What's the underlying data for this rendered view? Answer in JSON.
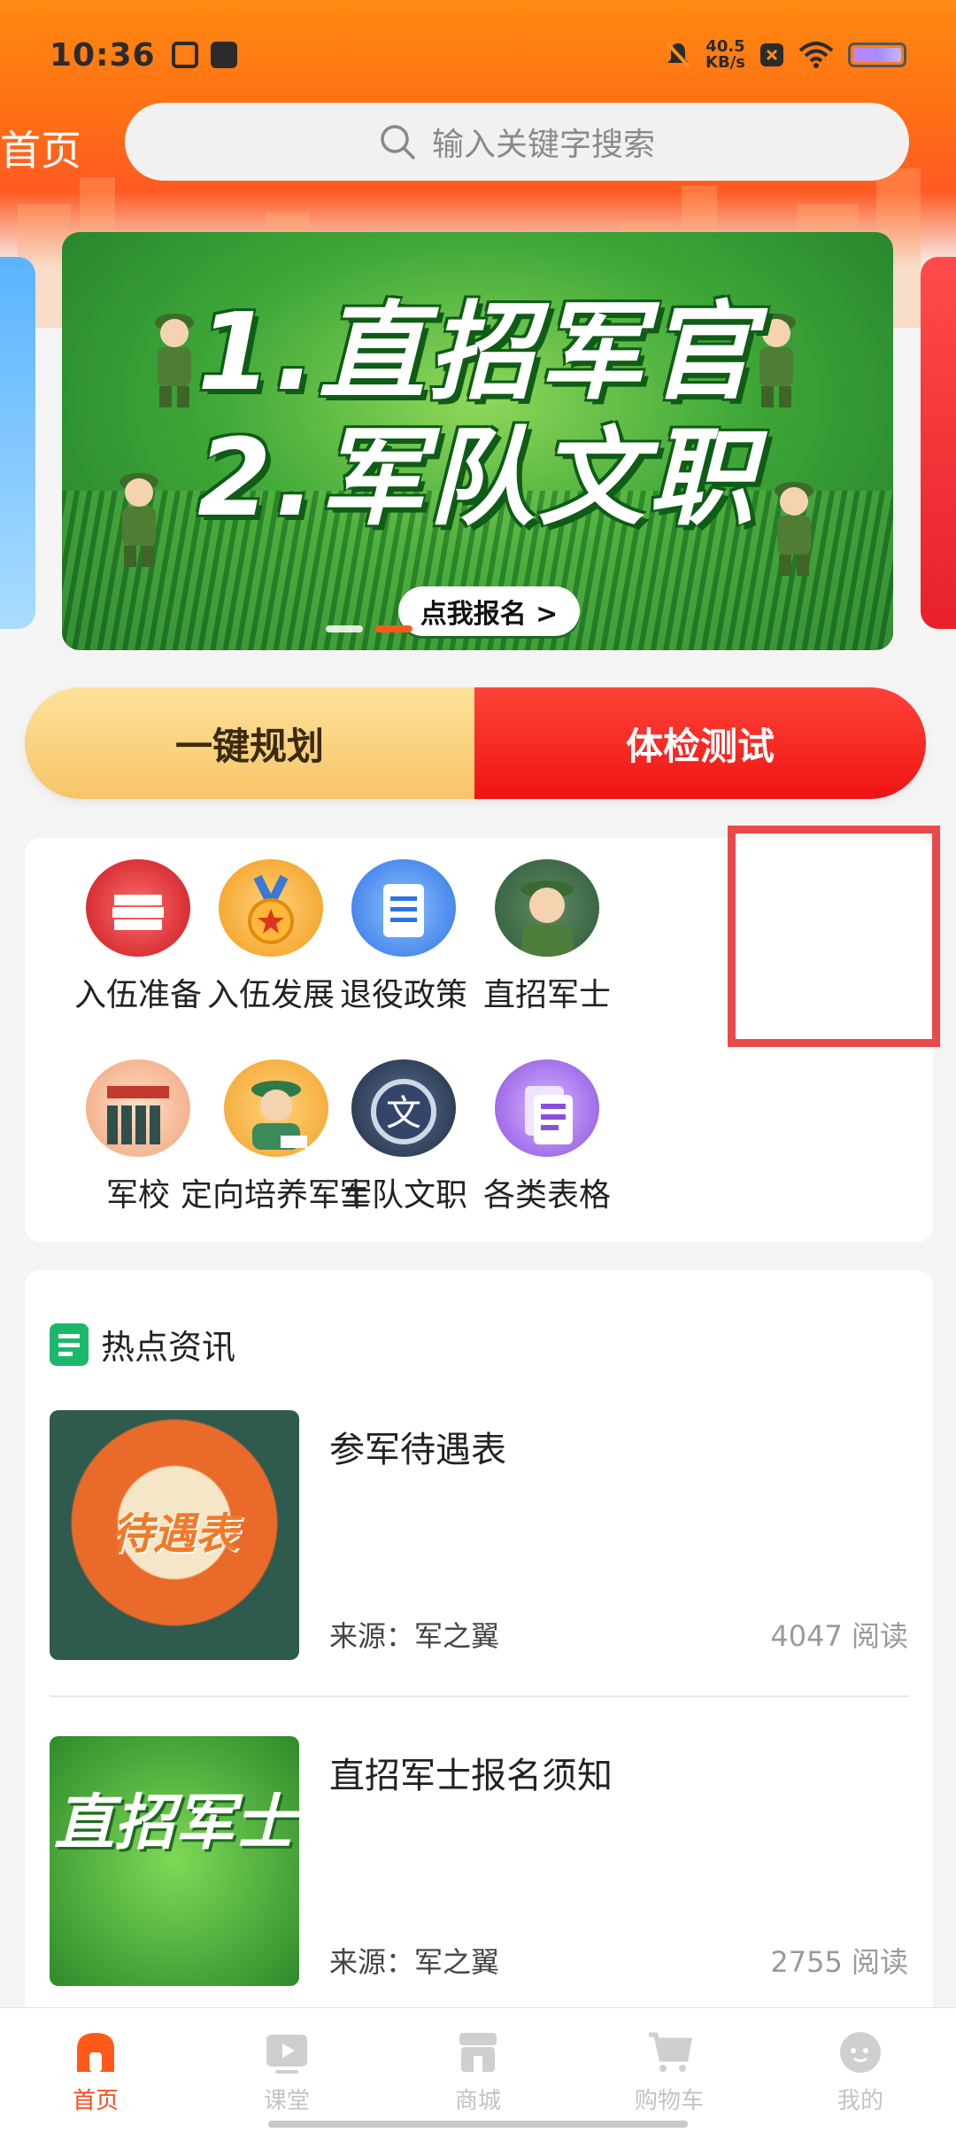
{
  "status_bar": {
    "time": "10:36",
    "speed_value": "40.5",
    "speed_unit": "KB/s",
    "icons": [
      "mute-icon",
      "close-box-icon",
      "wifi-icon",
      "battery-icon"
    ]
  },
  "header": {
    "title": "首页",
    "search_placeholder": "输入关键字搜索"
  },
  "banner": {
    "line1": "1.直招军官",
    "line2": "2.军队文职",
    "cta": "点我报名 >",
    "slide_count": 3,
    "active_slide": 2
  },
  "actions": {
    "left_label": "一键规划",
    "right_label": "体检测试"
  },
  "grid": {
    "items": [
      {
        "label": "入伍准备",
        "icon": "documents-icon"
      },
      {
        "label": "入伍发展",
        "icon": "medal-icon"
      },
      {
        "label": "退役政策",
        "icon": "document-icon"
      },
      {
        "label": "直招军士",
        "icon": "soldier-icon"
      },
      {
        "label": "军校",
        "icon": "parade-icon"
      },
      {
        "label": "定向培养军士",
        "icon": "officer-icon"
      },
      {
        "label": "军队文职",
        "icon": "wen-badge-icon"
      },
      {
        "label": "各类表格",
        "icon": "forms-icon"
      }
    ]
  },
  "news": {
    "section_title": "热点资讯",
    "items": [
      {
        "title": "参军待遇表",
        "source": "来源：军之翼",
        "reads": "4047 阅读",
        "thumb_text": "待遇表"
      },
      {
        "title": "直招军士报名须知",
        "source": "来源：军之翼",
        "reads": "2755 阅读",
        "thumb_text": "直招军士"
      }
    ]
  },
  "tabbar": {
    "items": [
      {
        "label": "首页",
        "icon": "home-icon",
        "active": true
      },
      {
        "label": "课堂",
        "icon": "play-icon",
        "active": false
      },
      {
        "label": "商城",
        "icon": "store-icon",
        "active": false
      },
      {
        "label": "购物车",
        "icon": "cart-icon",
        "active": false
      },
      {
        "label": "我的",
        "icon": "profile-icon",
        "active": false
      }
    ]
  },
  "colors": {
    "header_orange": "#ff7a12",
    "accent_red": "#ee1414",
    "accent_gold": "#f7c468",
    "tab_active": "#ff4a1a",
    "highlight_border": "#e84a4a"
  }
}
